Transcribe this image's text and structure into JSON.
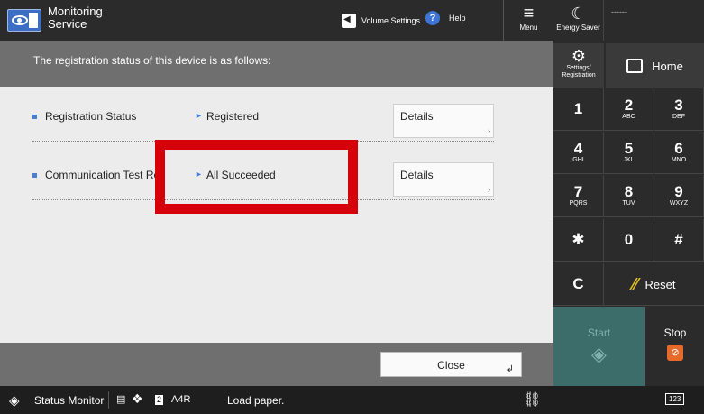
{
  "app": {
    "title_line1": "Monitoring",
    "title_line2": "Service"
  },
  "topbar": {
    "volume_label": "Volume Settings",
    "help_label": "Help",
    "menu_label": "Menu",
    "energy_label": "Energy Saver",
    "user_placeholder": "------"
  },
  "header": {
    "message": "The registration status of this device is as follows:"
  },
  "rows": [
    {
      "label": "Registration Status",
      "value": "Registered",
      "details": "Details"
    },
    {
      "label": "Communication Test Results",
      "value": "All Succeeded",
      "details": "Details"
    }
  ],
  "footer": {
    "close_label": "Close"
  },
  "panel": {
    "settings_line1": "Settings/",
    "settings_line2": "Registration",
    "home_label": "Home",
    "keys": [
      {
        "num": "1",
        "sub": ""
      },
      {
        "num": "2",
        "sub": "ABC"
      },
      {
        "num": "3",
        "sub": "DEF"
      },
      {
        "num": "4",
        "sub": "GHI"
      },
      {
        "num": "5",
        "sub": "JKL"
      },
      {
        "num": "6",
        "sub": "MNO"
      },
      {
        "num": "7",
        "sub": "PQRS"
      },
      {
        "num": "8",
        "sub": "TUV"
      },
      {
        "num": "9",
        "sub": "WXYZ"
      },
      {
        "num": "✱",
        "sub": ""
      },
      {
        "num": "0",
        "sub": ""
      },
      {
        "num": "#",
        "sub": ""
      },
      {
        "num": "C",
        "sub": ""
      }
    ],
    "reset_label": "Reset",
    "start_label": "Start",
    "stop_label": "Stop"
  },
  "statusbar": {
    "status_monitor": "Status Monitor",
    "tray": "2",
    "paper_size": "A4",
    "paper_flag": "R",
    "message": "Load paper.",
    "keyboard": "123"
  },
  "colors": {
    "highlight": "#d6000b",
    "start_bg": "#3c6d6b",
    "accent": "#4a7fcf"
  }
}
